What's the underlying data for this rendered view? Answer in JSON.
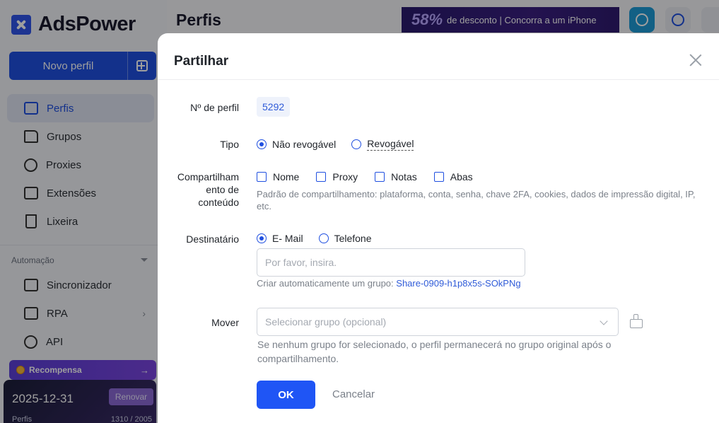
{
  "app": {
    "name": "AdsPower",
    "new_profile_label": "Novo perfil",
    "nav": [
      {
        "label": "Perfis",
        "icon": "profile-icon"
      },
      {
        "label": "Grupos",
        "icon": "folder-icon"
      },
      {
        "label": "Proxies",
        "icon": "globe-icon"
      },
      {
        "label": "Extensões",
        "icon": "puzzle-icon"
      },
      {
        "label": "Lixeira",
        "icon": "trash-icon"
      }
    ],
    "section_label": "Automação",
    "nav2": [
      {
        "label": "Sincronizador",
        "icon": "sync-grid-icon"
      },
      {
        "label": "RPA",
        "icon": "robot-icon"
      },
      {
        "label": "API",
        "icon": "plug-icon"
      }
    ],
    "reward": {
      "label": "Recompensa",
      "arrow": "→"
    },
    "plan": {
      "date": "2025-12-31",
      "button": "Renovar",
      "label": "Perfis",
      "count": "1310 / 2005"
    },
    "page_title": "Perfis",
    "banner": {
      "percent": "58%",
      "text": "de desconto | Concorra a um iPhone"
    },
    "colors": {
      "accent": "#1f4fe0",
      "sidebar_bg": "#f3f4f8"
    }
  },
  "modal": {
    "title": "Partilhar",
    "profile_number_label": "Nº de perfil",
    "profile_number": "5292",
    "type_label": "Tipo",
    "type_options": [
      "Não revogável",
      "Revogável"
    ],
    "type_selected": "Não revogável",
    "content_label": "Compartilhamento de conteúdo",
    "content_label_lines": [
      "Compartilham",
      "ento de",
      "conteúdo"
    ],
    "content_options": [
      "Nome",
      "Proxy",
      "Notas",
      "Abas"
    ],
    "content_hint": "Padrão de compartilhamento: plataforma, conta, senha, chave 2FA, cookies, dados de impressão digital, IP, etc.",
    "recipient_label": "Destinatário",
    "recipient_options": [
      "E- Mail",
      "Telefone"
    ],
    "recipient_selected": "E- Mail",
    "recipient_placeholder": "Por favor, insira.",
    "auto_group_text": "Criar automaticamente um grupo:",
    "auto_group_name": "Share-0909-h1p8x5s-SOkPNg",
    "move_label": "Mover",
    "move_placeholder": "Selecionar grupo (opcional)",
    "move_hint": "Se nenhum grupo for selecionado, o perfil permanecerá no grupo original após o compartilhamento.",
    "ok_label": "OK",
    "cancel_label": "Cancelar"
  }
}
